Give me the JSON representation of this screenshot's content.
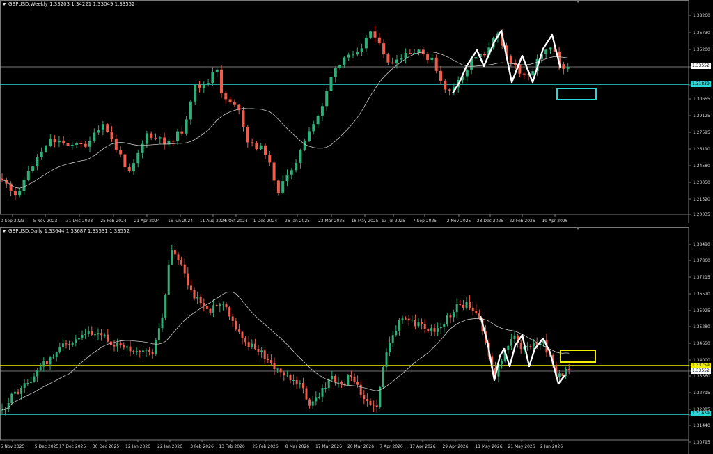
{
  "colors": {
    "bg": "#000000",
    "bull": "#2fae77",
    "bear": "#ee5d4c",
    "ma": "#c8c8c8",
    "cyan": "#2ad7d7",
    "yellow": "#f0f000",
    "pattern": "#ffffff",
    "grid": "#7a7a7a"
  },
  "weekly": {
    "title": "GBPUSD,Weekly  1.33203 1.34221 1.33049 1.33552",
    "price_labels": [
      "1.38260",
      "1.36730",
      "1.35200",
      "1.33552",
      "1.31839",
      "1.30655",
      "1.29125",
      "1.27595",
      "1.26110",
      "1.24580",
      "1.23050",
      "1.21520",
      "1.20035"
    ],
    "current_price": "1.33552",
    "support_price": "1.31839",
    "dates": [
      "0 Sep 2023",
      "5 Nov 2023",
      "31 Dec 2023",
      "25 Feb 2024",
      "21 Apr 2024",
      "16 Jun 2024",
      "11 Aug 2024",
      "6 Oct 2024",
      "1 Dec 2024",
      "26 Jan 2025",
      "23 Mar 2025",
      "18 May 2025",
      "13 Jul 2025",
      "7 Sep 2025",
      "2 Nov 2025",
      "28 Dec 2025",
      "22 Feb 2026",
      "19 Apr 2026"
    ]
  },
  "daily": {
    "title": "GBPUSD,Daily  1.33644 1.33687 1.33531 1.33552",
    "price_labels": [
      "1.38490",
      "1.37860",
      "1.37215",
      "1.36570",
      "1.35925",
      "1.35280",
      "1.34650",
      "1.34000",
      "1.33759",
      "1.33552",
      "1.33360",
      "1.32715",
      "1.32085",
      "1.31839",
      "1.31440",
      "1.30795"
    ],
    "current_price": "1.33552",
    "resistance_price": "1.33759",
    "support_price": "1.31839",
    "dates": [
      "5 Nov 2025",
      "5 Dec 2025",
      "17 Dec 2025",
      "30 Dec 2025",
      "12 Jan 2026",
      "22 Jan 2026",
      "3 Feb 2026",
      "13 Feb 2026",
      "25 Feb 2026",
      "8 Mar 2026",
      "17 Mar 2026",
      "26 Mar 2026",
      "7 Apr 2026",
      "17 Apr 2026",
      "29 Apr 2026",
      "11 May 2026",
      "21 May 2026",
      "2 Jun 2026"
    ]
  }
}
